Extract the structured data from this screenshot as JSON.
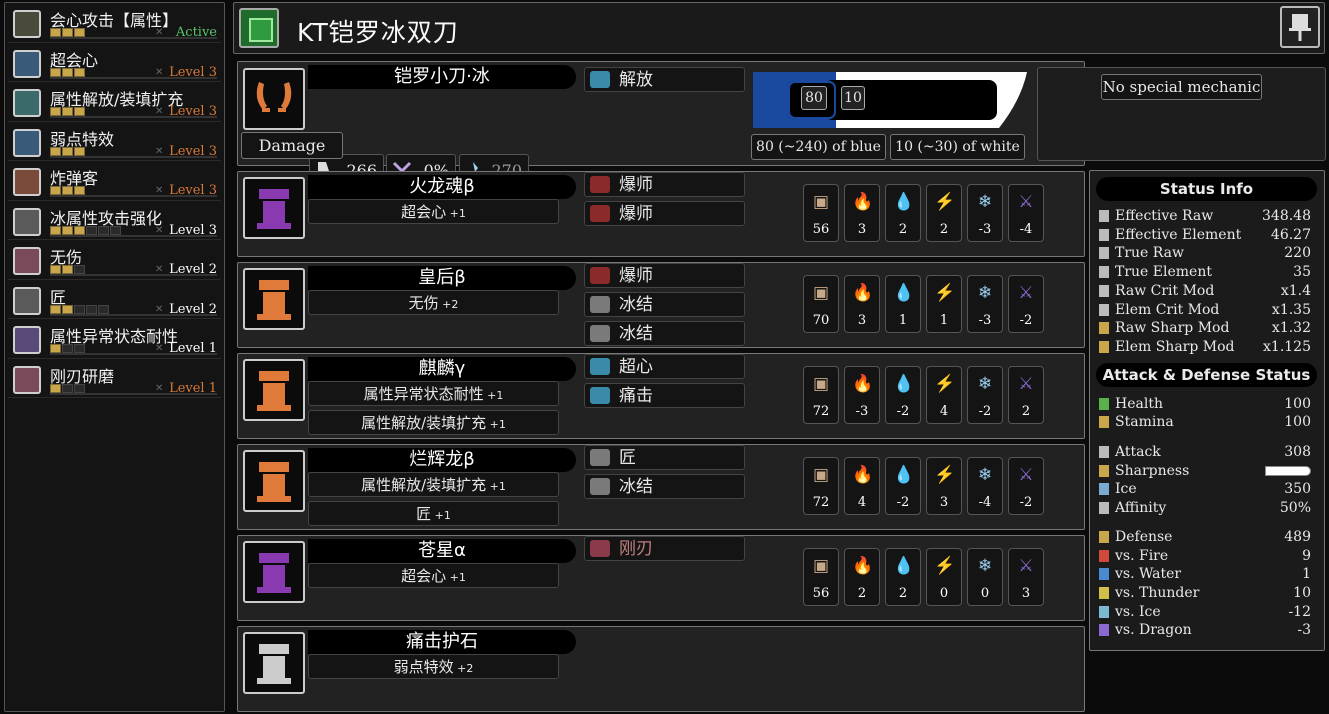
{
  "sidebar": {
    "skills": [
      {
        "name": "会心攻击【属性】",
        "level": "Active",
        "dots": 3,
        "max": 3,
        "color": "#59c26a",
        "icon": "#4a4a3a"
      },
      {
        "name": "超会心",
        "level": "Level 3",
        "dots": 3,
        "max": 3,
        "color": "#d97a3a",
        "icon": "#3a5a7a"
      },
      {
        "name": "属性解放/装填扩充",
        "level": "Level 3",
        "dots": 3,
        "max": 3,
        "color": "#d97a3a",
        "icon": "#3a6a6a"
      },
      {
        "name": "弱点特效",
        "level": "Level 3",
        "dots": 3,
        "max": 3,
        "color": "#d97a3a",
        "icon": "#3a5a7a"
      },
      {
        "name": "炸弹客",
        "level": "Level 3",
        "dots": 3,
        "max": 3,
        "color": "#d97a3a",
        "icon": "#7a4a3a"
      },
      {
        "name": "冰属性攻击强化",
        "level": "Level 3",
        "dots": 3,
        "max": 6,
        "color": "#ffffff",
        "icon": "#5a5a5a"
      },
      {
        "name": "无伤",
        "level": "Level 2",
        "dots": 2,
        "max": 3,
        "color": "#ffffff",
        "icon": "#7a4a5a"
      },
      {
        "name": "匠",
        "level": "Level 2",
        "dots": 2,
        "max": 5,
        "color": "#ffffff",
        "icon": "#5a5a5a"
      },
      {
        "name": "属性异常状态耐性",
        "level": "Level 1",
        "dots": 1,
        "max": 3,
        "color": "#ffffff",
        "icon": "#5a4a7a"
      },
      {
        "name": "刚刃研磨",
        "level": "Level 1",
        "dots": 1,
        "max": 3,
        "color": "#d97a3a",
        "icon": "#7a4a5a"
      }
    ]
  },
  "header": {
    "title": "KT铠罗冰双刀"
  },
  "weapon": {
    "name": "铠罗小刀·冰",
    "attack": "266",
    "affinity": "0%",
    "element": "270",
    "type_label": "Damage",
    "deco": "解放",
    "sharp_blue": "80",
    "sharp_white": "10",
    "blue_label": "80 (~240) of blue",
    "white_label": "10 (~30) of white",
    "mechanic": "No special mechanic"
  },
  "armor": [
    {
      "name": "火龙魂β",
      "skills": [
        {
          "t": "超会心",
          "l": "+1"
        }
      ],
      "decos": [
        {
          "t": "爆师",
          "c": "#8a2a2a"
        },
        {
          "t": "爆师",
          "c": "#8a2a2a"
        }
      ],
      "res": [
        "56",
        "3",
        "2",
        "2",
        "-3",
        "-4"
      ],
      "icon": "#8a3ab0"
    },
    {
      "name": "皇后β",
      "skills": [
        {
          "t": "无伤",
          "l": "+2"
        }
      ],
      "decos": [
        {
          "t": "爆师",
          "c": "#8a2a2a"
        },
        {
          "t": "冰结",
          "c": "#7a7a7a"
        },
        {
          "t": "冰结",
          "c": "#7a7a7a"
        }
      ],
      "res": [
        "70",
        "3",
        "1",
        "1",
        "-3",
        "-2"
      ],
      "icon": "#e07a3a"
    },
    {
      "name": "麒麟γ",
      "skills": [
        {
          "t": "属性异常状态耐性",
          "l": "+1"
        },
        {
          "t": "属性解放/装填扩充",
          "l": "+1"
        }
      ],
      "decos": [
        {
          "t": "超心",
          "c": "#3a8aaa"
        },
        {
          "t": "痛击",
          "c": "#3a8aaa"
        }
      ],
      "res": [
        "72",
        "-3",
        "-2",
        "4",
        "-2",
        "2"
      ],
      "icon": "#e07a3a"
    },
    {
      "name": "烂辉龙β",
      "skills": [
        {
          "t": "属性解放/装填扩充",
          "l": "+1"
        },
        {
          "t": "匠",
          "l": "+1"
        }
      ],
      "decos": [
        {
          "t": "匠",
          "c": "#7a7a7a"
        },
        {
          "t": "冰结",
          "c": "#7a7a7a"
        }
      ],
      "res": [
        "72",
        "4",
        "-2",
        "3",
        "-4",
        "-2"
      ],
      "icon": "#e07a3a"
    },
    {
      "name": "苍星α",
      "skills": [
        {
          "t": "超会心",
          "l": "+1"
        }
      ],
      "decos": [
        {
          "t": "刚刃",
          "c": "#8a3a4a",
          "dim": true
        }
      ],
      "res": [
        "56",
        "2",
        "2",
        "0",
        "0",
        "3"
      ],
      "icon": "#8a3ab0"
    },
    {
      "name": "痛击护石",
      "skills": [
        {
          "t": "弱点特效",
          "l": "+2"
        }
      ],
      "decos": [],
      "res": [],
      "icon": "#cccccc"
    }
  ],
  "status": {
    "title1": "Status Info",
    "info": [
      {
        "k": "Effective Raw",
        "v": "348.48",
        "c": "#bbb"
      },
      {
        "k": "Effective Element",
        "v": "46.27",
        "c": "#bbb"
      },
      {
        "k": "True Raw",
        "v": "220",
        "c": "#bbb"
      },
      {
        "k": "True Element",
        "v": "35",
        "c": "#bbb"
      },
      {
        "k": "Raw Crit Mod",
        "v": "x1.4",
        "c": "#bbb"
      },
      {
        "k": "Elem Crit Mod",
        "v": "x1.35",
        "c": "#bbb"
      },
      {
        "k": "Raw Sharp Mod",
        "v": "x1.32",
        "c": "#c9a64a"
      },
      {
        "k": "Elem Sharp Mod",
        "v": "x1.125",
        "c": "#c9a64a"
      }
    ],
    "title2": "Attack & Defense Status",
    "vitals": [
      {
        "k": "Health",
        "v": "100",
        "c": "#5ab04a"
      },
      {
        "k": "Stamina",
        "v": "100",
        "c": "#c9a64a"
      }
    ],
    "attack": [
      {
        "k": "Attack",
        "v": "308",
        "c": "#bbb"
      },
      {
        "k": "Sharpness",
        "v": "",
        "c": "#c9a64a"
      },
      {
        "k": "Ice",
        "v": "350",
        "c": "#7aaad0"
      },
      {
        "k": "Affinity",
        "v": "50%",
        "c": "#bbb"
      }
    ],
    "defense": [
      {
        "k": "Defense",
        "v": "489",
        "c": "#c9a64a"
      },
      {
        "k": "vs. Fire",
        "v": "9",
        "c": "#d04a3a"
      },
      {
        "k": "vs. Water",
        "v": "1",
        "c": "#4a8ad0"
      },
      {
        "k": "vs. Thunder",
        "v": "10",
        "c": "#d0c04a"
      },
      {
        "k": "vs. Ice",
        "v": "-12",
        "c": "#7abad0"
      },
      {
        "k": "vs. Dragon",
        "v": "-3",
        "c": "#8a6ad0"
      }
    ]
  },
  "res_icons": [
    {
      "name": "defense-icon",
      "c": "#c9a888",
      "g": "▣"
    },
    {
      "name": "fire-icon",
      "c": "#f04a2a",
      "g": "🔥"
    },
    {
      "name": "water-icon",
      "c": "#5ab8f0",
      "g": "💧"
    },
    {
      "name": "thunder-icon",
      "c": "#f0e02a",
      "g": "⚡"
    },
    {
      "name": "ice-icon",
      "c": "#9ad0f0",
      "g": "❄"
    },
    {
      "name": "dragon-icon",
      "c": "#8a6ad0",
      "g": "⚔"
    }
  ]
}
